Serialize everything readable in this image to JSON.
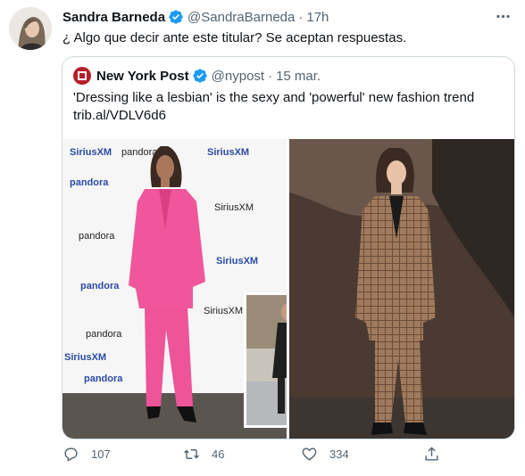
{
  "tweet": {
    "author_name": "Sandra Barneda",
    "handle": "@SandraBarneda",
    "separator": "·",
    "time": "17h",
    "text": "¿ Algo que decir ante este titular? Se aceptan respuestas."
  },
  "quoted": {
    "author_name": "New York Post",
    "handle": "@nypost",
    "separator": "·",
    "date": "15 mar.",
    "headline": "'Dressing like a lesbian' is the sexy and 'powerful' new fashion trend",
    "link": "trib.al/VDLV6d6",
    "backdrop_logos": [
      "SiriusXM",
      "pandora",
      "SiriusXM",
      "pandora",
      "SiriusXM",
      "pandora",
      "SiriusXM",
      "pandora",
      "SiriusXM",
      "pandora",
      "SiriusXM",
      "pandora"
    ]
  },
  "actions": {
    "reply_count": "107",
    "retweet_count": "46",
    "like_count": "334"
  },
  "colors": {
    "verified": "#1d9bf0",
    "text": "#0f1419",
    "muted": "#536471",
    "border": "#cfd9de",
    "nypost_red": "#b51f2b",
    "pink_suit": "#f0569b",
    "plaid_suit": "#a07a5c"
  },
  "icons": [
    "verified-badge-icon",
    "more-icon",
    "reply-icon",
    "retweet-icon",
    "like-icon",
    "share-icon"
  ]
}
